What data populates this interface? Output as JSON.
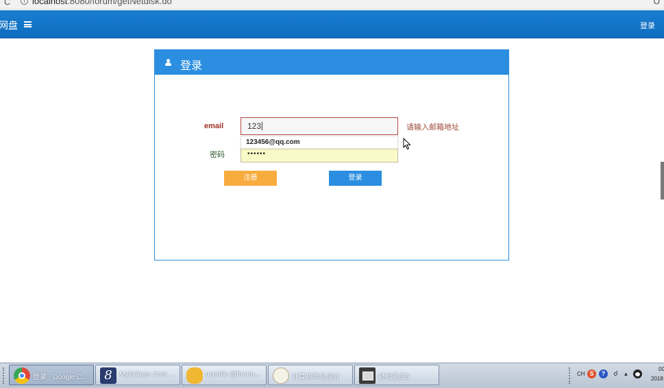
{
  "browser": {
    "url_host": "localhost",
    "url_rest": ":8080/forum/getNetdisk.do",
    "reload_glyph": "C",
    "info_glyph": "i",
    "extension_glyph": "O"
  },
  "navbar": {
    "brand": "网盘",
    "menu_icon": "hamburger-icon",
    "login_link": "登录"
  },
  "login_panel": {
    "title": "登录",
    "title_icon": "user-icon",
    "email": {
      "label": "email",
      "value": "123",
      "hint": "请输入邮箱地址",
      "autocomplete_suggestion": "123456@qq.com"
    },
    "password": {
      "label": "密码",
      "masked_value": "••••••"
    },
    "register_button": "注册",
    "login_button": "登录"
  },
  "taskbar": {
    "tasks": [
      {
        "label": "登录 - Google C...",
        "icon": "chrome-icon",
        "active": true
      },
      {
        "label": "MyEclipse Java ...",
        "icon": "myeclipse-icon",
        "active": false
      },
      {
        "label": "userfile @forum...",
        "icon": "user-folder-icon",
        "active": false
      },
      {
        "label": "计算机毕业设计",
        "icon": "calligraphy-icon",
        "active": false
      },
      {
        "label": "轻松录屏5",
        "icon": "screen-recorder-icon",
        "active": false
      }
    ],
    "tray": {
      "input_method": "CH",
      "clock_line1": "00",
      "clock_line2": "2018"
    }
  },
  "colors": {
    "navbar": "#1a7fd0",
    "panel_accent": "#2b8ee0",
    "register_button": "#f8ac3e",
    "error_text": "#a03326",
    "password_fill": "#fafac8"
  }
}
